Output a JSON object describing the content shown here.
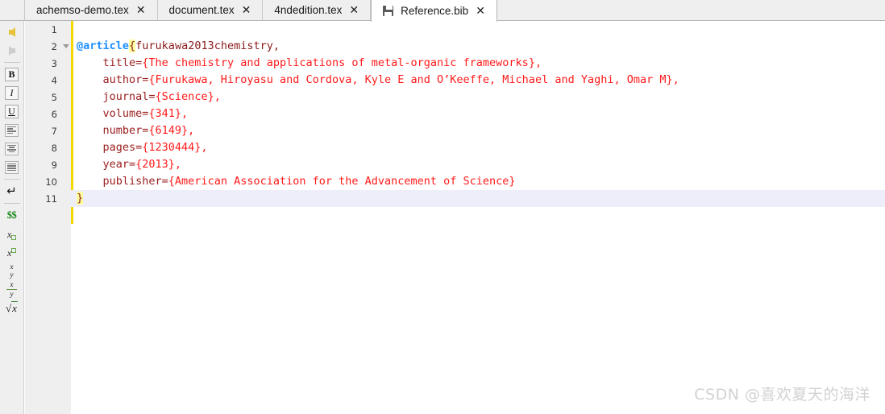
{
  "tabs": [
    {
      "label": "achemso-demo.tex",
      "close": "✕",
      "active": false,
      "icon": null
    },
    {
      "label": "document.tex",
      "close": "✕",
      "active": false,
      "icon": null
    },
    {
      "label": "4ndedition.tex",
      "close": "✕",
      "active": false,
      "icon": null
    },
    {
      "label": "Reference.bib",
      "close": "✕",
      "active": true,
      "icon": "save-icon"
    }
  ],
  "toolbar": {
    "items": [
      {
        "name": "undo-arrow-icon",
        "glyph": "◀",
        "label": "Undo"
      },
      {
        "name": "redo-arrow-icon",
        "glyph": "▶",
        "label": "Redo"
      },
      {
        "name": "bold-button",
        "glyph": "B",
        "label": "Bold"
      },
      {
        "name": "italic-button",
        "glyph": "I",
        "label": "Italic"
      },
      {
        "name": "underline-button",
        "glyph": "U",
        "label": "Underline"
      },
      {
        "name": "align-left-button",
        "glyph": "",
        "label": "Align left"
      },
      {
        "name": "align-center-button",
        "glyph": "",
        "label": "Align center"
      },
      {
        "name": "align-justify-button",
        "glyph": "",
        "label": "Justify"
      },
      {
        "name": "newline-button",
        "glyph": "↵",
        "label": "New line"
      },
      {
        "name": "math-inline-button",
        "glyph": "$$",
        "label": "Math mode"
      },
      {
        "name": "subscript-button",
        "glyph": "x□",
        "label": "Subscript"
      },
      {
        "name": "superscript-button",
        "glyph": "x□",
        "label": "Superscript"
      },
      {
        "name": "binom-button",
        "glyph": "x/y",
        "label": "Binomial"
      },
      {
        "name": "fraction-button",
        "glyph": "x/y",
        "label": "Fraction"
      },
      {
        "name": "sqrt-button",
        "glyph": "√x",
        "label": "Square root"
      }
    ],
    "math_x": "x",
    "math_y": "y",
    "dollar": "$$",
    "enter": "↵",
    "sqrt_sign": "√"
  },
  "editor": {
    "lines": [
      {
        "num": "1",
        "fold": false,
        "current": false,
        "tokens": []
      },
      {
        "num": "2",
        "fold": true,
        "current": false,
        "tokens": [
          {
            "cls": "kw",
            "text": "@article"
          },
          {
            "cls": "brmatch",
            "text": "{"
          },
          {
            "cls": "citekey",
            "text": "furukawa2013chemistry,"
          }
        ]
      },
      {
        "num": "3",
        "fold": false,
        "current": false,
        "tokens": [
          {
            "cls": "field",
            "text": "    title="
          },
          {
            "cls": "val",
            "text": "{The chemistry and applications of metal-organic frameworks},"
          }
        ]
      },
      {
        "num": "4",
        "fold": false,
        "current": false,
        "tokens": [
          {
            "cls": "field",
            "text": "    author="
          },
          {
            "cls": "val",
            "text": "{Furukawa, Hiroyasu and Cordova, Kyle E and O’Keeffe, Michael and Yaghi, Omar M},"
          }
        ]
      },
      {
        "num": "5",
        "fold": false,
        "current": false,
        "tokens": [
          {
            "cls": "field",
            "text": "    journal="
          },
          {
            "cls": "val",
            "text": "{Science},"
          }
        ]
      },
      {
        "num": "6",
        "fold": false,
        "current": false,
        "tokens": [
          {
            "cls": "field",
            "text": "    volume="
          },
          {
            "cls": "val",
            "text": "{341},"
          }
        ]
      },
      {
        "num": "7",
        "fold": false,
        "current": false,
        "tokens": [
          {
            "cls": "field",
            "text": "    number="
          },
          {
            "cls": "val",
            "text": "{6149},"
          }
        ]
      },
      {
        "num": "8",
        "fold": false,
        "current": false,
        "tokens": [
          {
            "cls": "field",
            "text": "    pages="
          },
          {
            "cls": "val",
            "text": "{1230444},"
          }
        ]
      },
      {
        "num": "9",
        "fold": false,
        "current": false,
        "tokens": [
          {
            "cls": "field",
            "text": "    year="
          },
          {
            "cls": "val",
            "text": "{2013},"
          }
        ]
      },
      {
        "num": "10",
        "fold": false,
        "current": false,
        "tokens": [
          {
            "cls": "field",
            "text": "    publisher="
          },
          {
            "cls": "val",
            "text": "{American Association for the Advancement of Science}"
          }
        ]
      },
      {
        "num": "11",
        "fold": false,
        "current": true,
        "tokens": [
          {
            "cls": "brmatch",
            "text": "}"
          }
        ]
      }
    ]
  },
  "watermark": {
    "text": "CSDN @喜欢夏天的海洋"
  },
  "colors": {
    "keyword": "#1e90ff",
    "value": "#ff1a1a",
    "field": "#9b2020",
    "bracket_match_bg": "#ffff9e",
    "change_bar": "#f5d800",
    "current_line_bg": "#eeeefb",
    "chrome_bg": "#efefef"
  }
}
